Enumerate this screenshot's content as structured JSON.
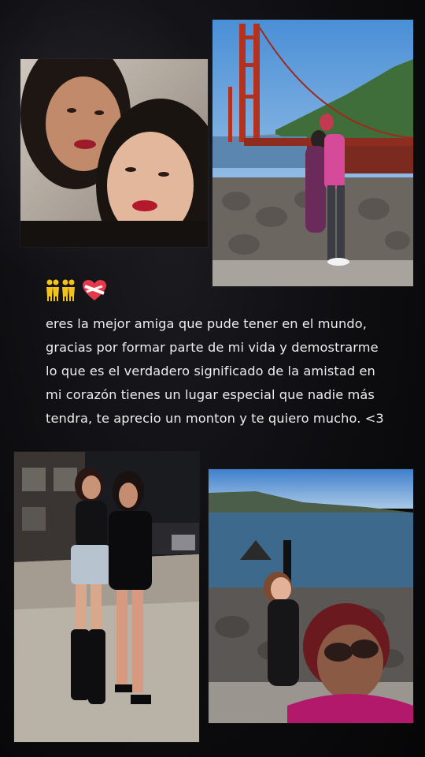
{
  "story": {
    "caption": "eres la mejor amiga que pude tener en el mundo, gracias por formar parte de mi vida y demostrarme lo que es el verdadero significado de la amistad en mi corazón tienes un lugar especial que nadie más tendra, te aprecio un monton y te quiero mucho. <3",
    "emojis": [
      "women-holding-hands-icon",
      "women-holding-hands-icon",
      "mending-heart-icon"
    ],
    "photos": [
      {
        "name": "photo-selfie-1",
        "subject": "two-women-selfie"
      },
      {
        "name": "photo-bridge",
        "subject": "golden-gate-bridge-hug"
      },
      {
        "name": "photo-night",
        "subject": "two-women-night-out"
      },
      {
        "name": "photo-coast",
        "subject": "coastal-selfie"
      }
    ]
  },
  "colors": {
    "background": "#0b0b0d",
    "text": "#ededee",
    "heart": "#e23a4a"
  }
}
